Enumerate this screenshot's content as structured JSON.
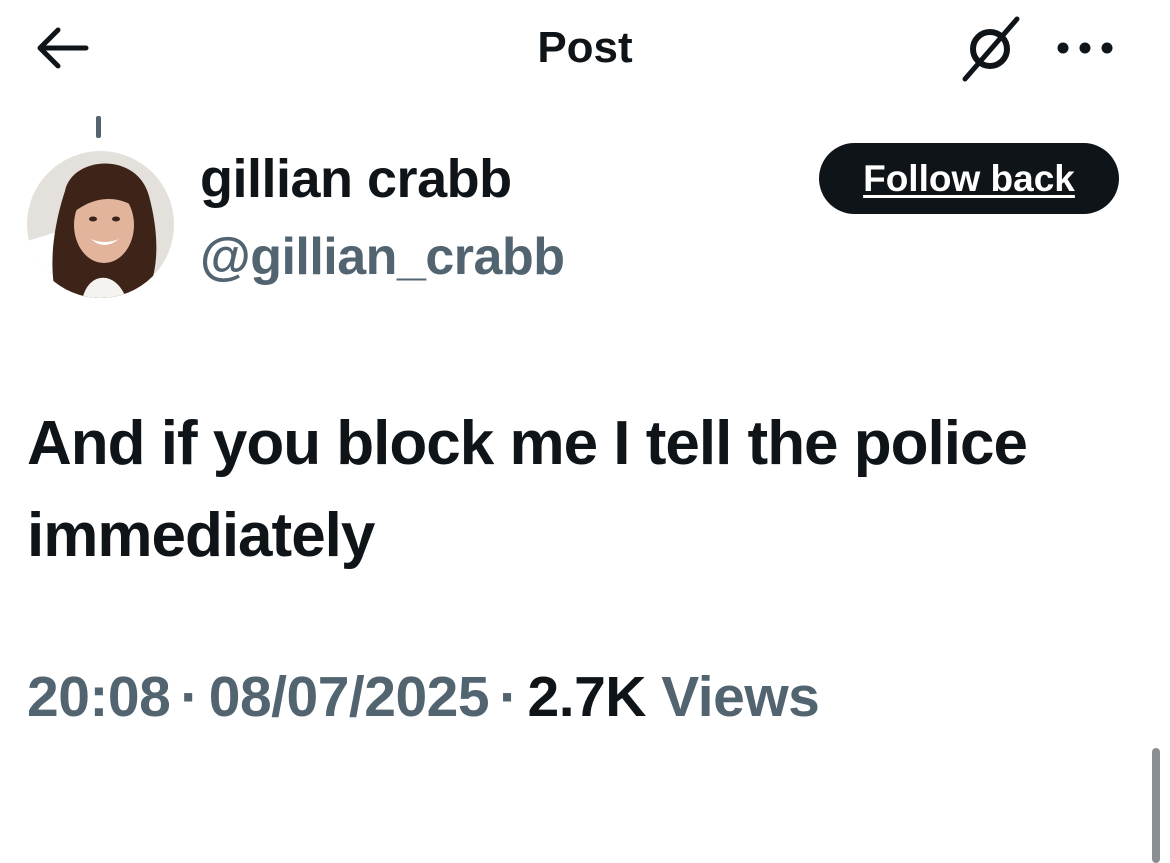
{
  "header": {
    "title": "Post",
    "back_icon": "arrow-left-icon",
    "grok_icon": "grok-icon",
    "more_icon": "more-dots-icon"
  },
  "author": {
    "display_name": "gillian crabb",
    "handle": "@gillian_crabb",
    "follow_label": "Follow back"
  },
  "post": {
    "text": "And if you block me I tell the police immediately",
    "time": "20:08",
    "date": "08/07/2025",
    "views_count": "2.7K",
    "views_label": "Views",
    "separator": "·"
  },
  "colors": {
    "primary_text": "#0f1419",
    "secondary_text": "#536471",
    "button_bg": "#0f1419",
    "button_text": "#ffffff"
  }
}
